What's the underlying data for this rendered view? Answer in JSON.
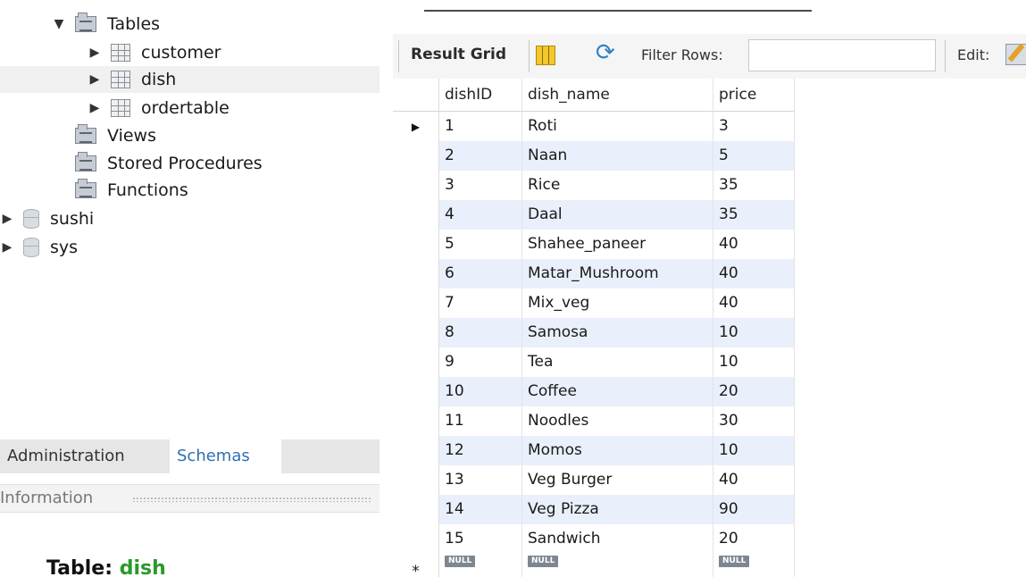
{
  "navigator": {
    "tree": [
      {
        "label": "Tables",
        "kind": "folder",
        "expanded": true
      },
      {
        "label": "customer",
        "kind": "table"
      },
      {
        "label": "dish",
        "kind": "table",
        "selected": true
      },
      {
        "label": "ordertable",
        "kind": "table"
      },
      {
        "label": "Views",
        "kind": "folder"
      },
      {
        "label": "Stored Procedures",
        "kind": "folder"
      },
      {
        "label": "Functions",
        "kind": "folder"
      },
      {
        "label": "sushi",
        "kind": "database"
      },
      {
        "label": "sys",
        "kind": "database"
      }
    ],
    "expanded_arrow": "▼",
    "collapsed_arrow": "▶",
    "tabs": {
      "administration": "Administration",
      "schemas": "Schemas"
    },
    "info_label": "Information",
    "table_info": {
      "prefix": "Table:",
      "name": "dish"
    }
  },
  "toolbar": {
    "result_grid_label": "Result Grid",
    "filter_label": "Filter Rows:",
    "filter_value": "",
    "edit_label": "Edit:",
    "icons": [
      "grid-layout-icon",
      "refresh-icon",
      "edit-icon"
    ]
  },
  "grid": {
    "columns": [
      "dishID",
      "dish_name",
      "price"
    ],
    "current_row_marker": "▶",
    "new_row_marker": "*",
    "null_label": "NULL",
    "rows": [
      [
        "1",
        "Roti",
        "3"
      ],
      [
        "2",
        "Naan",
        "5"
      ],
      [
        "3",
        "Rice",
        "35"
      ],
      [
        "4",
        "Daal",
        "35"
      ],
      [
        "5",
        "Shahee_paneer",
        "40"
      ],
      [
        "6",
        "Matar_Mushroom",
        "40"
      ],
      [
        "7",
        "Mix_veg",
        "40"
      ],
      [
        "8",
        "Samosa",
        "10"
      ],
      [
        "9",
        "Tea",
        "10"
      ],
      [
        "10",
        "Coffee",
        "20"
      ],
      [
        "11",
        "Noodles",
        "30"
      ],
      [
        "12",
        "Momos",
        "10"
      ],
      [
        "13",
        "Veg Burger",
        "40"
      ],
      [
        "14",
        "Veg Pizza",
        "90"
      ],
      [
        "15",
        "Sandwich",
        "20"
      ]
    ]
  },
  "colors": {
    "alt_row": "#e9f0fb",
    "schemas_tab": "#2f6fb3",
    "table_name": "#2a9a2a"
  }
}
